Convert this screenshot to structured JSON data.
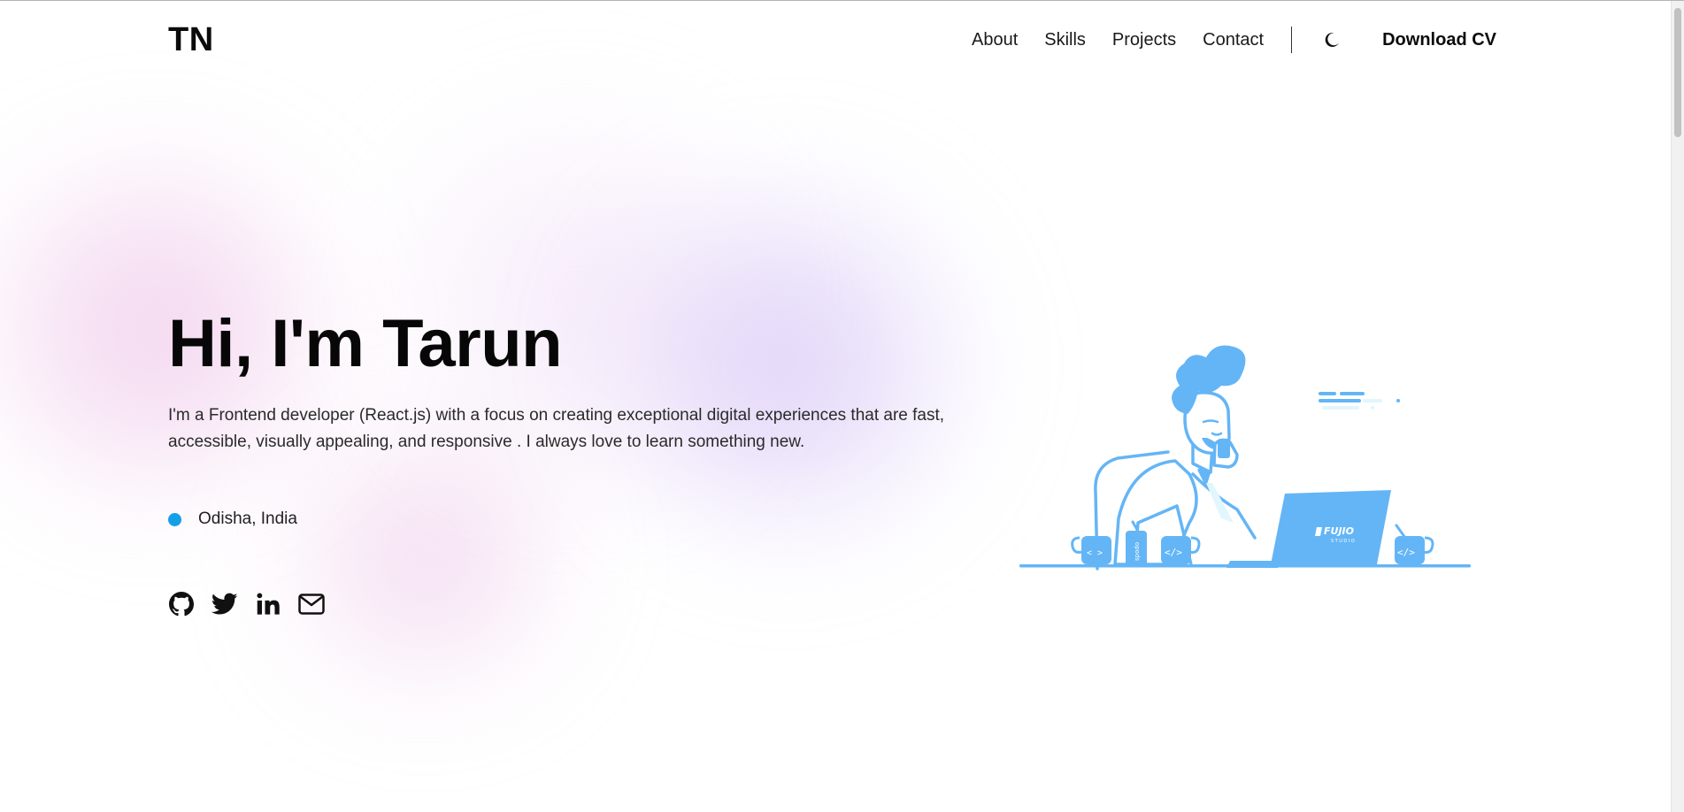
{
  "nav": {
    "logo": "TN",
    "links": [
      "About",
      "Skills",
      "Projects",
      "Contact"
    ],
    "theme_icon": "moon-icon",
    "download_cv": "Download CV"
  },
  "hero": {
    "title": "Hi, I'm Tarun",
    "description": "I'm a Frontend developer (React.js) with a focus on creating exceptional digital experiences that are fast, accessible, visually appealing, and responsive . I always love to learn something new.",
    "location": "Odisha, India",
    "location_dot_color": "#14a0e8",
    "socials": [
      "github-icon",
      "twitter-icon",
      "linkedin-icon",
      "mail-icon"
    ]
  },
  "illustration": {
    "laptop_brand": "FUJIO",
    "laptop_sub": "STUDIO",
    "mug_left": "< >",
    "mug_center": "</>",
    "mug_right": "</>",
    "can_label": "spodo",
    "accent_color": "#64b5f6"
  }
}
